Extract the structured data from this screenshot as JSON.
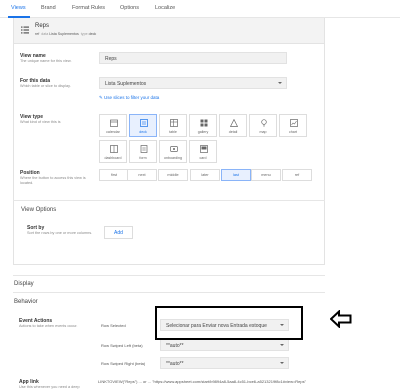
{
  "tabs": [
    "Views",
    "Brand",
    "Format Rules",
    "Options",
    "Localize"
  ],
  "active_tab": "Views",
  "accent_color": "#1a73e8",
  "view": {
    "title": "Reps",
    "meta_type": "ref",
    "meta_data_label": "data",
    "meta_data": "Lista Suplementos",
    "meta_view_label": "type",
    "meta_view_type": "deck",
    "icon": "list-icon"
  },
  "view_name": {
    "label": "View name",
    "desc": "The unique name for this view.",
    "value": "Reps"
  },
  "for_this_data": {
    "label": "For this data",
    "desc": "Which table or slice to display.",
    "value": "Lista Suplementos",
    "slice_link": "Use slices to filter your data"
  },
  "view_type": {
    "label": "View type",
    "desc": "What kind of view this is",
    "options": [
      {
        "name": "calendar",
        "icon": "calendar-icon"
      },
      {
        "name": "deck",
        "icon": "deck-icon"
      },
      {
        "name": "table",
        "icon": "table-icon"
      },
      {
        "name": "gallery",
        "icon": "gallery-icon"
      },
      {
        "name": "detail",
        "icon": "detail-icon"
      },
      {
        "name": "map",
        "icon": "map-pin-icon"
      },
      {
        "name": "chart",
        "icon": "chart-icon"
      },
      {
        "name": "dashboard",
        "icon": "dashboard-icon"
      },
      {
        "name": "form",
        "icon": "form-icon"
      },
      {
        "name": "onboarding",
        "icon": "onboarding-icon"
      },
      {
        "name": "card",
        "icon": "card-icon"
      }
    ],
    "selected": "deck"
  },
  "position": {
    "label": "Position",
    "desc": "Where the button to access this view is located.",
    "options": [
      "first",
      "next",
      "middle",
      "later",
      "last",
      "menu",
      "ref"
    ],
    "selected": "last"
  },
  "view_options": {
    "title": "View Options",
    "sort_label": "Sort by",
    "sort_desc": "Sort the rows by one or more columns.",
    "add_label": "Add"
  },
  "display": {
    "title": "Display"
  },
  "behavior": {
    "title": "Behavior",
    "event_actions_label": "Event Actions",
    "event_actions_desc": "Actions to take when events occur.",
    "rows": [
      {
        "label": "Row Selected",
        "value": "Selecionar para Enviar nova Entrada estoque"
      },
      {
        "label": "Row Swiped Left (beta)",
        "value": "**auto**"
      },
      {
        "label": "Row Swiped Right (beta)",
        "value": "**auto**"
      }
    ],
    "app_link_label": "App link",
    "app_link_desc": "Use this whenever you need a deep",
    "app_link_value": "LINKTOVIEW(\"Reps\") ... or ...  \"https://www.appsheet.com/start/b9894a8-5aa8-4c51-bce6-a5213219f8c1#view=Reps\""
  }
}
